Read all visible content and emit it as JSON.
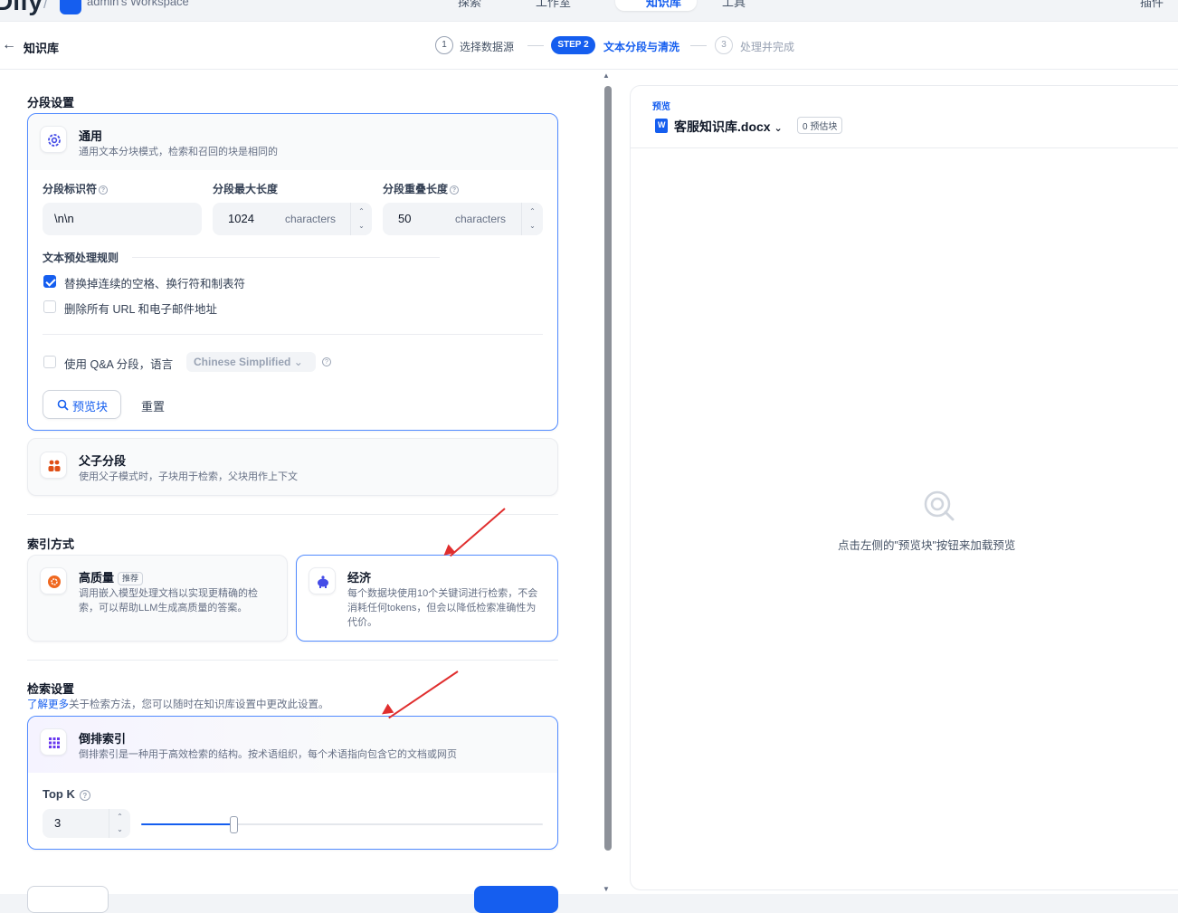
{
  "topbar": {
    "logo": "Dify",
    "workspace": "admin's Workspace",
    "nav": [
      "探索",
      "工作室",
      "知识库",
      "工具"
    ],
    "plugins": "插件"
  },
  "header": {
    "back_title": "知识库",
    "steps": [
      {
        "num": "1",
        "label": "选择数据源"
      },
      {
        "num": "STEP 2",
        "label": "文本分段与清洗"
      },
      {
        "num": "3",
        "label": "处理并完成"
      }
    ]
  },
  "segment": {
    "section_title": "分段设置",
    "general": {
      "title": "通用",
      "desc": "通用文本分块模式，检索和召回的块是相同的",
      "identifier_label": "分段标识符",
      "identifier_value": "\\n\\n",
      "max_len_label": "分段最大长度",
      "max_len_value": "1024",
      "max_len_unit": "characters",
      "overlap_label": "分段重叠长度",
      "overlap_value": "50",
      "overlap_unit": "characters",
      "rules_label": "文本预处理规则",
      "rule1": "替换掉连续的空格、换行符和制表符",
      "rule1_checked": true,
      "rule2": "删除所有 URL 和电子邮件地址",
      "rule2_checked": false,
      "qa_label": "使用 Q&A 分段，语言",
      "qa_checked": false,
      "qa_language": "Chinese Simplified",
      "preview_button": "预览块",
      "reset_button": "重置"
    },
    "parent_child": {
      "title": "父子分段",
      "desc": "使用父子模式时，子块用于检索，父块用作上下文"
    }
  },
  "index": {
    "section_title": "索引方式",
    "high_quality": {
      "title": "高质量",
      "tag": "推荐",
      "desc": "调用嵌入模型处理文档以实现更精确的检索，可以帮助LLM生成高质量的答案。"
    },
    "economy": {
      "title": "经济",
      "desc": "每个数据块使用10个关键词进行检索，不会消耗任何tokens，但会以降低检索准确性为代价。"
    }
  },
  "retrieval": {
    "section_title": "检索设置",
    "learn_more": "了解更多",
    "note": "关于检索方法，您可以随时在知识库设置中更改此设置。",
    "inverted": {
      "title": "倒排索引",
      "desc": "倒排索引是一种用于高效检索的结构。按术语组织，每个术语指向包含它的文档或网页"
    },
    "topk_label": "Top K",
    "topk_value": "3",
    "topk_fraction": 0.23
  },
  "preview": {
    "label": "预览",
    "filename": "客服知识库.docx",
    "count_badge": "0 预估块",
    "empty_text": "点击左侧的\"预览块\"按钮来加载预览"
  },
  "colors": {
    "accent": "#155eef",
    "annotation_arrow": "#e02e2e"
  }
}
